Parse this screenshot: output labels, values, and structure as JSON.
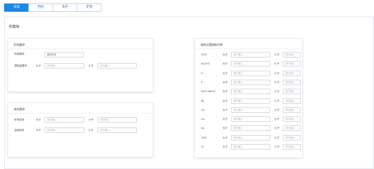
{
  "tabs": [
    {
      "label": "答案"
    },
    {
      "label": "档统"
    },
    {
      "label": "发护"
    },
    {
      "label": "定销"
    }
  ],
  "page_title": "的案库",
  "panel_mine": {
    "title": "矿粉要求",
    "type_label": "料质要求",
    "type_select": "国内矿粉",
    "size_label": "颗粒度要求",
    "max_label": "大于",
    "min_label": "小于",
    "placeholder": "请行输入"
  },
  "panel_cost": {
    "title": "成本要求",
    "row1_label": "矿粉成本",
    "row2_label": "返回成本",
    "max_label": "大于",
    "min_label": "小于",
    "placeholder": "请行输入"
  },
  "panel_elements": {
    "title": "其他元素指标约束",
    "max_label": "大于",
    "min_label": "小于",
    "placeholder": "请行输入",
    "elements": [
      "SiO2",
      "AL2O3",
      "S",
      "P",
      "K2O+Na2O",
      "Pb",
      "Zn",
      "Cu",
      "As",
      "TiO2",
      "Cl"
    ]
  }
}
